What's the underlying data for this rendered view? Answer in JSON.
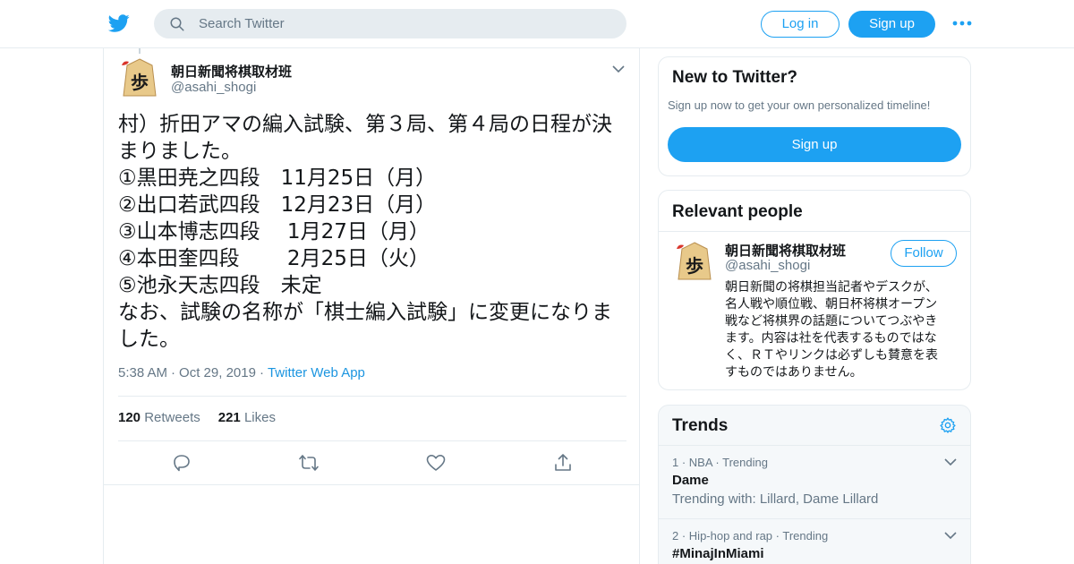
{
  "header": {
    "search_placeholder": "Search Twitter",
    "login_label": "Log in",
    "signup_label": "Sign up",
    "brand_color": "#1da1f2"
  },
  "tweet": {
    "display_name": "朝日新聞将棋取材班",
    "handle": "@asahi_shogi",
    "text_lines": [
      "村）折田アマの編入試験、第３局、第４局の日程が決",
      "まりました。",
      "①黒田尭之四段　11月25日（月）",
      "②出口若武四段　12月23日（月）",
      "③山本博志四段　 1月27日（月）",
      "④本田奎四段　　 2月25日（火）",
      "⑤池永天志四段　未定",
      "なお、試験の名称が「棋士編入試験」に変更になりま",
      "した。"
    ],
    "time": "5:38 AM",
    "date": "Oct 29, 2019",
    "source": "Twitter Web App",
    "retweets_count": "120",
    "retweets_label": "Retweets",
    "likes_count": "221",
    "likes_label": "Likes"
  },
  "sidebar": {
    "new_to_twitter": {
      "title": "New to Twitter?",
      "subtitle": "Sign up now to get your own personalized timeline!",
      "signup_label": "Sign up"
    },
    "relevant_people": {
      "title": "Relevant people",
      "name": "朝日新聞将棋取材班",
      "handle": "@asahi_shogi",
      "follow_label": "Follow",
      "bio_lines": [
        "朝日新聞の将棋担当記者やデスクが、",
        "名人戦や順位戦、朝日杯将棋オープン",
        "戦など将棋界の話題についてつぶやき",
        "ます。内容は社を代表するものではな",
        "く、ＲＴやリンクは必ずしも賛意を表",
        "すものではありません。"
      ]
    },
    "trends": {
      "title": "Trends",
      "items": [
        {
          "rank": "1",
          "category": "NBA",
          "status": "Trending",
          "name": "Dame",
          "with": "Trending with: Lillard, Dame Lillard"
        },
        {
          "rank": "2",
          "category": "Hip-hop and rap",
          "status": "Trending",
          "name": "#MinajInMiami"
        }
      ]
    }
  }
}
